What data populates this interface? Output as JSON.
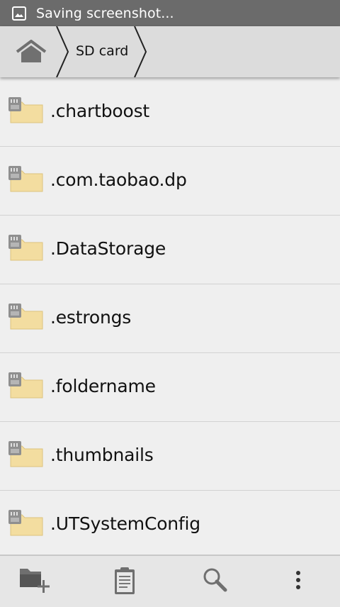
{
  "status_bar": {
    "notification_icon": "image-icon",
    "text": "Saving screenshot..."
  },
  "breadcrumb": {
    "home_icon": "home-icon",
    "items": [
      {
        "label": "SD card"
      }
    ]
  },
  "files": [
    {
      "name": ".chartboost",
      "icon": "sdcard-folder-icon"
    },
    {
      "name": ".com.taobao.dp",
      "icon": "sdcard-folder-icon"
    },
    {
      "name": ".DataStorage",
      "icon": "sdcard-folder-icon"
    },
    {
      "name": ".estrongs",
      "icon": "sdcard-folder-icon"
    },
    {
      "name": ".foldername",
      "icon": "sdcard-folder-icon"
    },
    {
      "name": ".thumbnails",
      "icon": "sdcard-folder-icon"
    },
    {
      "name": ".UTSystemConfig",
      "icon": "sdcard-folder-icon"
    }
  ],
  "toolbar": {
    "buttons": [
      {
        "icon": "new-folder-icon"
      },
      {
        "icon": "clipboard-icon"
      },
      {
        "icon": "search-icon"
      },
      {
        "icon": "overflow-menu-icon"
      }
    ]
  },
  "colors": {
    "status_bar": "#6b6b6b",
    "breadcrumb_bar": "#dcdcdc",
    "list_background": "#efefef",
    "folder": "#f3dda0",
    "toolbar": "#e6e6e6"
  }
}
